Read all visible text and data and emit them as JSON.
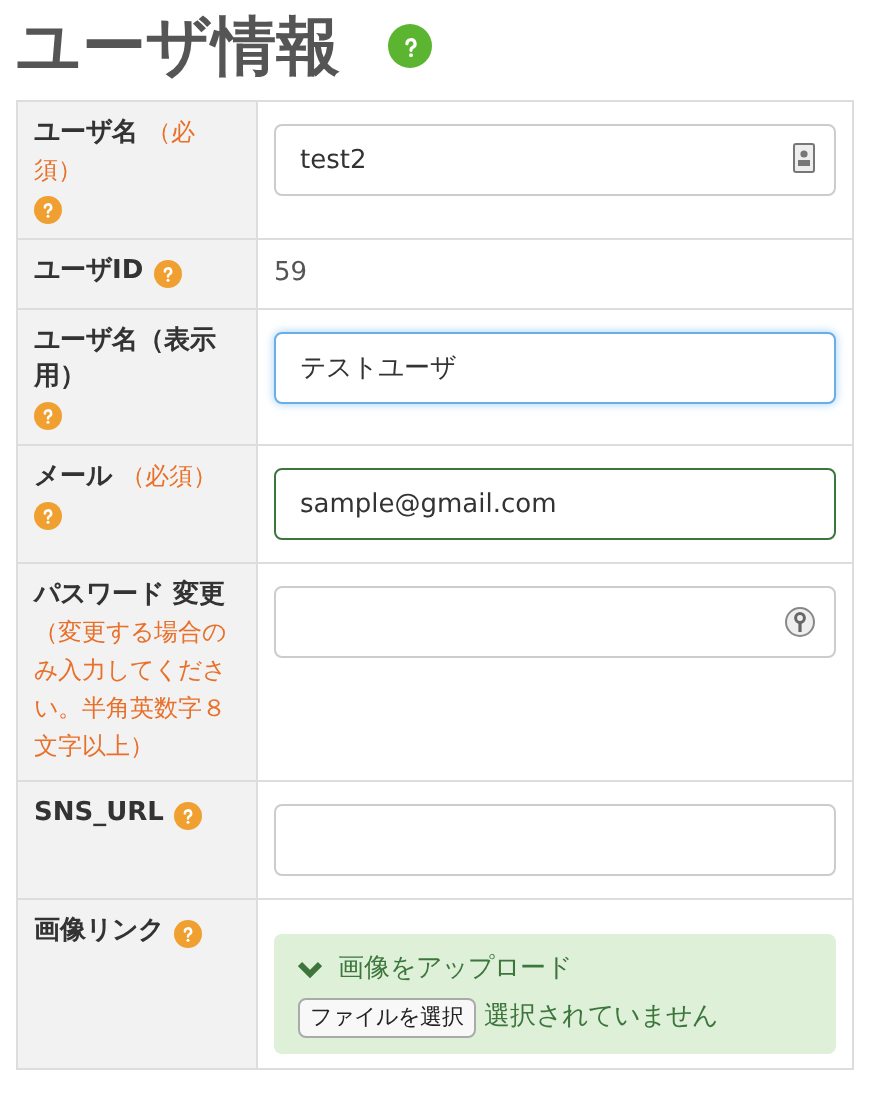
{
  "title": "ユーザ情報",
  "rows": [
    {
      "label": "ユーザ名",
      "note": "（必須）",
      "help": true,
      "kind": "input",
      "field": {
        "value": "test2",
        "focused": false,
        "valid": false,
        "kind": "account"
      }
    },
    {
      "label": "ユーザID",
      "help": true,
      "kind": "text",
      "value": "59"
    },
    {
      "label": "ユーザ名（表示用）",
      "help": true,
      "kind": "input",
      "field": {
        "value": "テストユーザ",
        "focused": true,
        "valid": false,
        "kind": "plain"
      }
    },
    {
      "label": "メール",
      "note": "（必須）",
      "help": true,
      "kind": "input",
      "field": {
        "value": "sample@gmail.com",
        "focused": false,
        "valid": true,
        "kind": "plain"
      }
    },
    {
      "label": "パスワード 変更",
      "note": "（変更する場合のみ入力してください。半角英数字８文字以上）",
      "help": false,
      "kind": "input",
      "field": {
        "focused": false,
        "valid": false,
        "kind": "password"
      }
    },
    {
      "label": "SNS_URL",
      "help": true,
      "kind": "input",
      "field": {
        "focused": false,
        "valid": false,
        "kind": "plain"
      }
    },
    {
      "label": "画像リンク",
      "help": true,
      "kind": "upload",
      "upload": {
        "heading": "画像をアップロード",
        "button": "ファイルを選択",
        "status": "選択されていません"
      }
    }
  ]
}
